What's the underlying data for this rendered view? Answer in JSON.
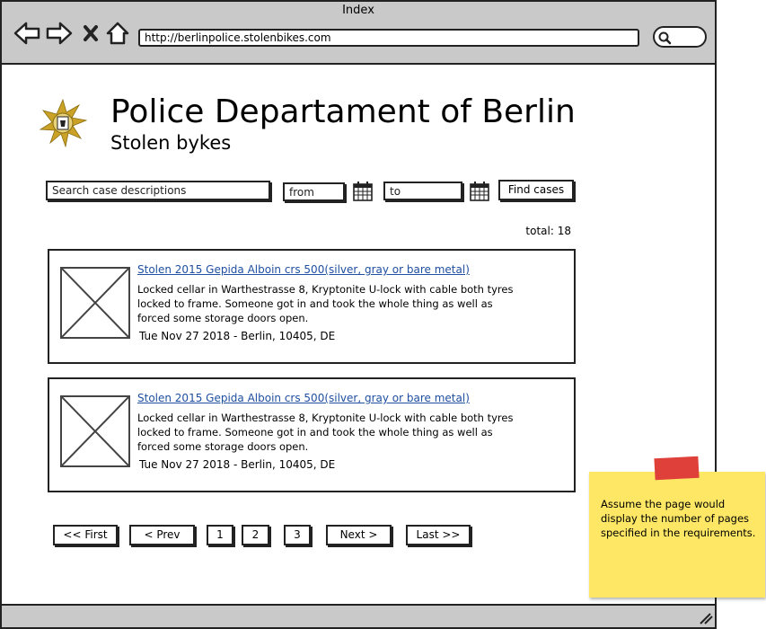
{
  "browser": {
    "title": "Index",
    "url": "http://berlinpolice.stolenbikes.com"
  },
  "header": {
    "title": "Police Departament of Berlin",
    "subtitle": "Stolen bykes"
  },
  "search": {
    "description_placeholder": "Search case descriptions",
    "from_placeholder": "from",
    "to_placeholder": "to",
    "find_label": "Find cases"
  },
  "total_label": "total: 18",
  "cases": [
    {
      "title": "Stolen 2015 Gepida Alboin crs 500(silver, gray or bare metal)",
      "description": "Locked cellar in Warthestrasse 8, Kryptonite U-lock with cable both tyres locked to frame. Someone got in and took the whole thing as well as forced some storage doors open.",
      "meta": "Tue Nov 27 2018 - Berlin, 10405, DE"
    },
    {
      "title": "Stolen 2015 Gepida Alboin crs 500(silver, gray or bare metal)",
      "description": "Locked cellar in Warthestrasse 8, Kryptonite U-lock with cable both tyres locked to frame. Someone got in and took the whole thing as well as forced some storage doors open.",
      "meta": "Tue Nov 27 2018 - Berlin, 10405, DE"
    }
  ],
  "pagination": {
    "first": "<< First",
    "prev": "< Prev",
    "pages": [
      "1",
      "2",
      "3"
    ],
    "next": "Next >",
    "last": "Last >>"
  },
  "note": {
    "text": "Assume the page would display the number of pages specified in the requirements."
  },
  "colors": {
    "chrome": "#c9c9c9",
    "link": "#1f4fa0",
    "note": "#fde765",
    "note_tape": "#e0403a",
    "badge_gold": "#c9a227"
  }
}
